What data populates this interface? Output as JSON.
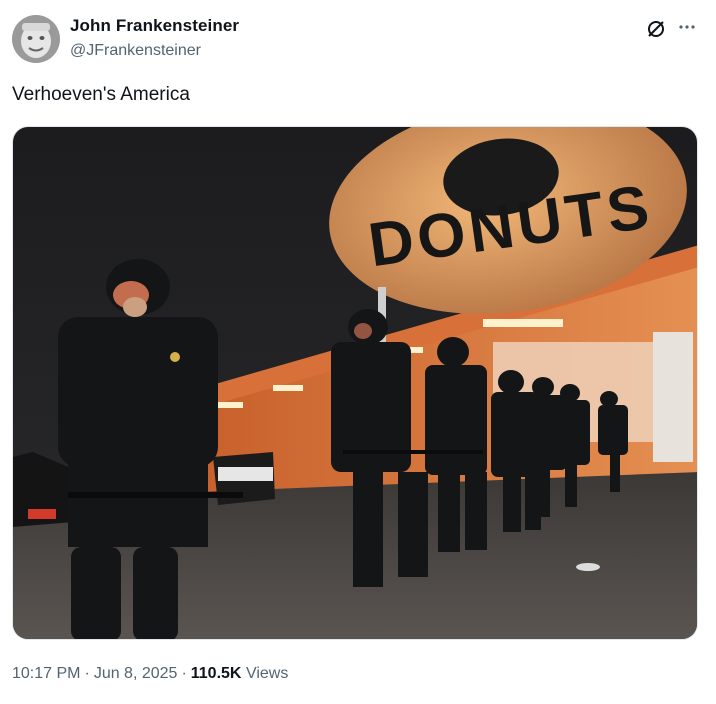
{
  "author": {
    "name": "John Frankensteiner",
    "handle": "@JFrankensteiner"
  },
  "tweet": {
    "text": "Verhoeven's America"
  },
  "media": {
    "sign_text": "DONUTS"
  },
  "meta": {
    "time": "10:17 PM",
    "date": "Jun 8, 2025",
    "views_count": "110.5K",
    "views_label": "Views",
    "separator": "·"
  },
  "icons": {
    "grok": "grok-slash-circle-icon",
    "more": "more-horizontal-dots-icon"
  },
  "colors": {
    "text_primary": "#0f1419",
    "text_secondary": "#536471",
    "border": "#e1e8ed"
  }
}
